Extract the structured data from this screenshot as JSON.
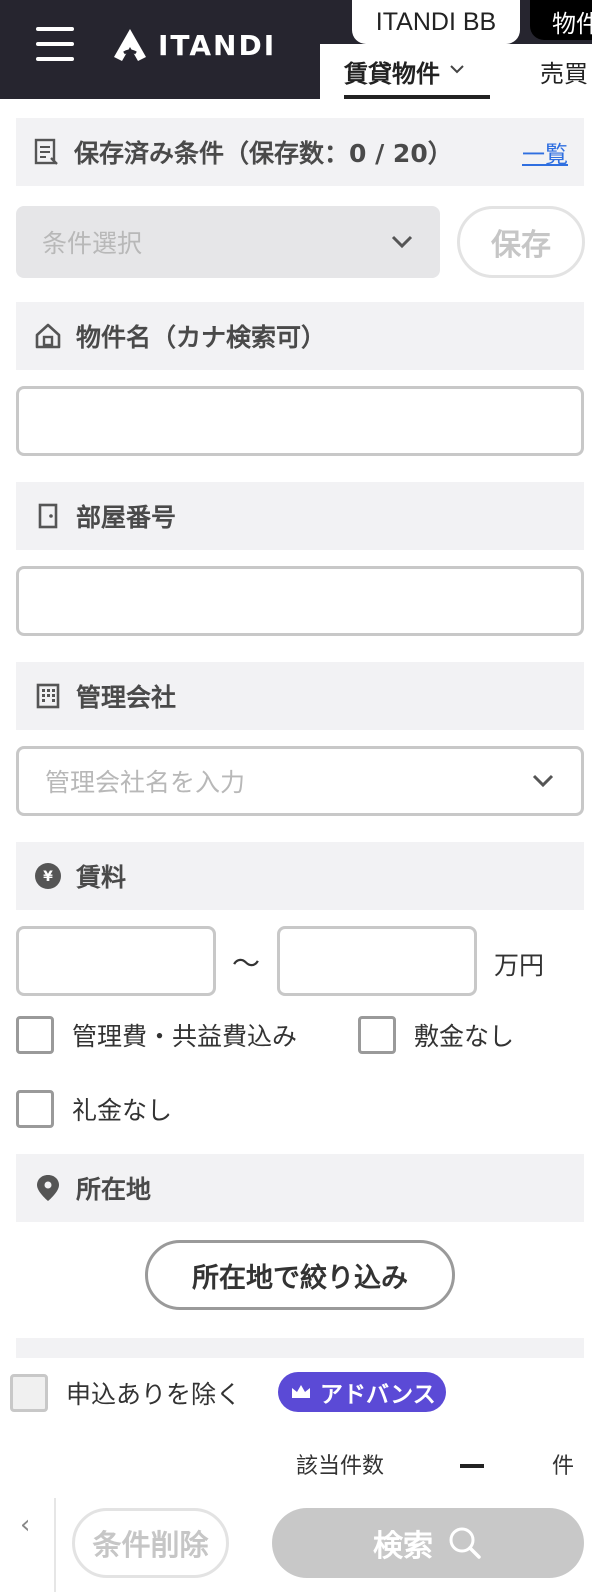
{
  "header": {
    "logo_text": "ITANDI",
    "tab_bb": "ITANDI BB",
    "tab_bb2": "物件",
    "sub_tab_active": "賃貸物件",
    "sub_tab_2": "売買"
  },
  "saved_conditions": {
    "title": "保存済み条件（保存数：0 / 20）",
    "list_link": "一覧",
    "select_placeholder": "条件選択",
    "save_button": "保存"
  },
  "property_name": {
    "title": "物件名（カナ検索可）",
    "value": ""
  },
  "room_number": {
    "title": "部屋番号",
    "value": ""
  },
  "management_company": {
    "title": "管理会社",
    "placeholder": "管理会社名を入力"
  },
  "rent": {
    "title": "賃料",
    "min": "",
    "max": "",
    "range_sep": "～",
    "unit": "万円",
    "options": [
      {
        "label": "管理費・共益費込み",
        "checked": false
      },
      {
        "label": "敷金なし",
        "checked": false
      },
      {
        "label": "礼金なし",
        "checked": false
      }
    ]
  },
  "location": {
    "title": "所在地",
    "filter_button": "所在地で絞り込み"
  },
  "bottom_bar": {
    "exclude_applied_label": "申込ありを除く",
    "exclude_applied_checked": false,
    "advance_badge": "アドバンス",
    "count_label": "該当件数",
    "count_value": "ー",
    "count_unit": "件",
    "clear_button": "条件削除",
    "search_button": "検索"
  },
  "colors": {
    "header_bg": "#26252f",
    "section_bg": "#f2f2f4",
    "link": "#2f6fe0",
    "advance_badge": "#5b4ad6",
    "search_button_bg": "#c8c8c8"
  }
}
